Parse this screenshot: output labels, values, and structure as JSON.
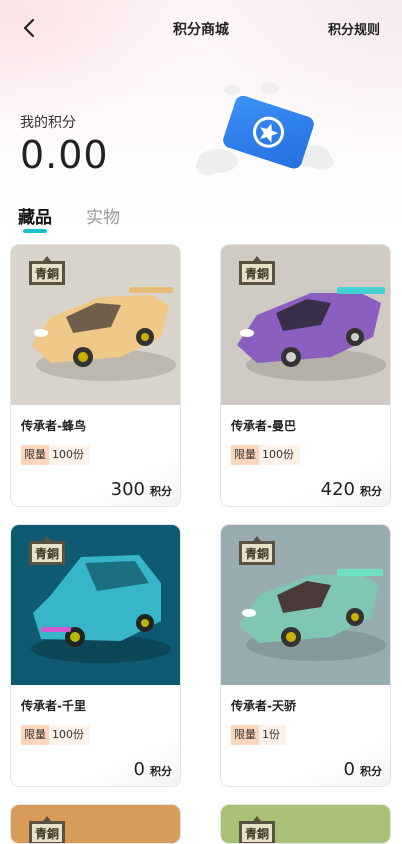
{
  "header": {
    "title": "积分商城",
    "rules_label": "积分规则"
  },
  "points": {
    "label": "我的积分",
    "value": "0.00"
  },
  "tabs": [
    {
      "label": "藏品",
      "active": true
    },
    {
      "label": "实物",
      "active": false
    }
  ],
  "badge_text": "青銅",
  "items": [
    {
      "name": "传承者-蜂鸟",
      "limit_tag": "限量",
      "limit_qty": "100份",
      "price": "300",
      "unit": "积分",
      "bg": "#d8d4cc",
      "car": "#f0c887"
    },
    {
      "name": "传承者-曼巴",
      "limit_tag": "限量",
      "limit_qty": "100份",
      "price": "420",
      "unit": "积分",
      "bg": "#cfcbc4",
      "car": "#8a5fc0"
    },
    {
      "name": "传承者-千里",
      "limit_tag": "限量",
      "limit_qty": "100份",
      "price": "0",
      "unit": "积分",
      "bg": "#0f5a73",
      "car": "#38b6c9"
    },
    {
      "name": "传承者-天骄",
      "limit_tag": "限量",
      "limit_qty": "1份",
      "price": "0",
      "unit": "积分",
      "bg": "#99acb2",
      "car": "#7fc6b5"
    },
    {
      "name": "",
      "bg": "#d99b5a"
    },
    {
      "name": "",
      "bg": "#a9c077"
    }
  ]
}
